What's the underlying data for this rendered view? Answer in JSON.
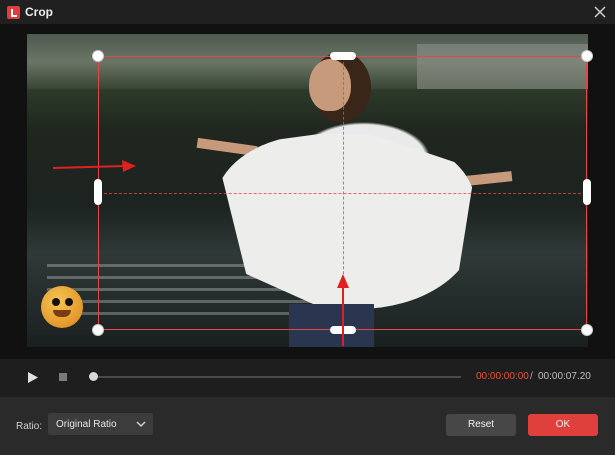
{
  "window": {
    "title": "Crop",
    "app_icon": "app-logo-icon",
    "close_icon": "close-icon"
  },
  "player": {
    "current_time": "00:00:00:00",
    "separator": "/",
    "total_time": "00:00:07.20",
    "progress": 0.0,
    "play_icon": "play-icon",
    "stop_icon": "stop-icon"
  },
  "crop": {
    "guide_color": "#e14848",
    "arrow_icons": [
      "arrow-right-icon",
      "arrow-up-icon"
    ]
  },
  "footer": {
    "ratio_label": "Ratio:",
    "ratio_value": "Original Ratio",
    "reset_label": "Reset",
    "ok_label": "OK"
  },
  "colors": {
    "accent": "#e0403b",
    "time_current": "#e5533f"
  }
}
